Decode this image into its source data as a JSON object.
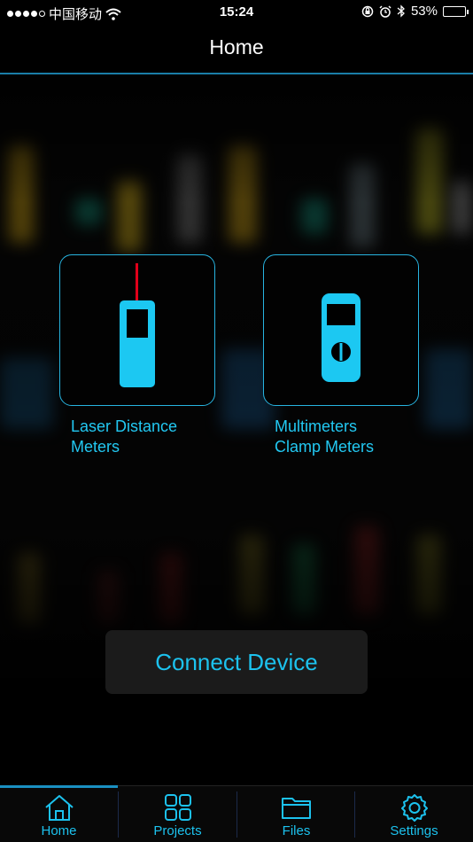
{
  "status_bar": {
    "carrier": "中国移动",
    "time": "15:24",
    "battery_percent": "53%",
    "battery_level": 0.53,
    "icons": [
      "signal-dots-icon",
      "wifi-icon",
      "orientation-lock-icon",
      "alarm-icon",
      "bluetooth-icon",
      "battery-icon"
    ]
  },
  "nav": {
    "title": "Home"
  },
  "tiles": [
    {
      "label_line1": "Laser Distance",
      "label_line2": "Meters",
      "icon": "laser-distance-meter-icon"
    },
    {
      "label_line1": "Multimeters",
      "label_line2": "Clamp Meters",
      "icon": "multimeter-icon"
    }
  ],
  "connect_button": {
    "label": "Connect Device"
  },
  "tabs": [
    {
      "label": "Home",
      "icon": "home-icon",
      "active": true
    },
    {
      "label": "Projects",
      "icon": "projects-grid-icon",
      "active": false
    },
    {
      "label": "Files",
      "icon": "folder-icon",
      "active": false
    },
    {
      "label": "Settings",
      "icon": "settings-gear-icon",
      "active": false
    }
  ],
  "colors": {
    "accent": "#1cc2ee",
    "tile_border": "#27b4e0",
    "nav_line": "#1a7ea8",
    "laser": "#e0001a"
  }
}
